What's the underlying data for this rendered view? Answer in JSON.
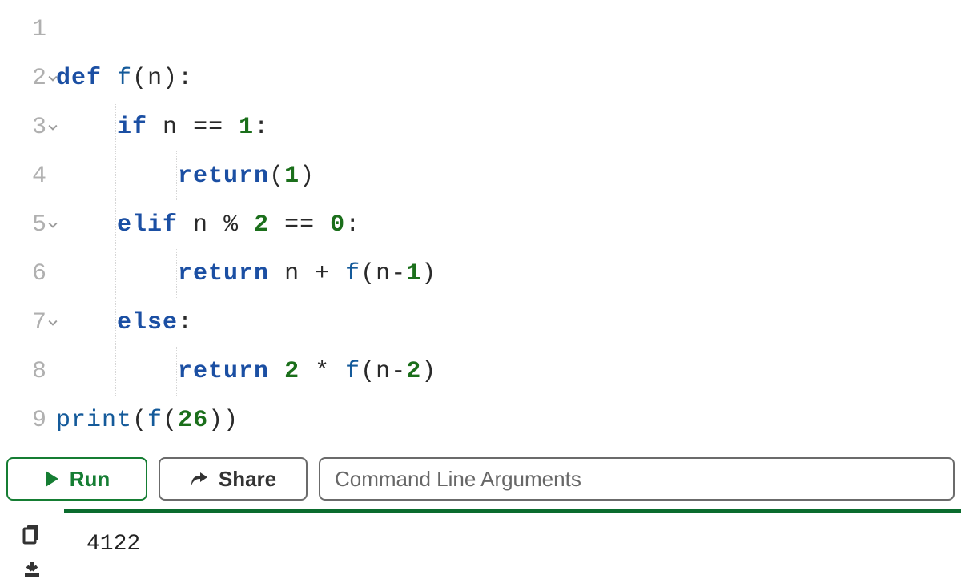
{
  "gutter": {
    "lines": [
      "1",
      "2",
      "3",
      "4",
      "5",
      "6",
      "7",
      "8",
      "9"
    ],
    "foldable": [
      false,
      true,
      true,
      false,
      true,
      false,
      true,
      false,
      false
    ]
  },
  "code": {
    "l1": "",
    "l2": {
      "kw_def": "def",
      "fn": "f",
      "lp": "(",
      "arg": "n",
      "rp": ")",
      "colon": ":"
    },
    "l3": {
      "kw_if": "if",
      "id": "n",
      "op": "==",
      "num": "1",
      "colon": ":"
    },
    "l4": {
      "kw_return": "return",
      "lp": "(",
      "num": "1",
      "rp": ")"
    },
    "l5": {
      "kw_elif": "elif",
      "id": "n",
      "mod": "%",
      "two": "2",
      "op": "==",
      "zero": "0",
      "colon": ":"
    },
    "l6": {
      "kw_return": "return",
      "id_n": "n",
      "plus": "+",
      "fn": "f",
      "lp": "(",
      "id_n2": "n",
      "minus": "-",
      "one": "1",
      "rp": ")"
    },
    "l7": {
      "kw_else": "else",
      "colon": ":"
    },
    "l8": {
      "kw_return": "return",
      "two": "2",
      "star": "*",
      "fn": "f",
      "lp": "(",
      "id_n": "n",
      "minus": "-",
      "two2": "2",
      "rp": ")"
    },
    "l9": {
      "fn_print": "print",
      "lp": "(",
      "fn_f": "f",
      "lp2": "(",
      "num": "26",
      "rp2": ")",
      "rp": ")"
    }
  },
  "toolbar": {
    "run_label": "Run",
    "share_label": "Share",
    "cli_placeholder": "Command Line Arguments"
  },
  "output": {
    "text": "4122"
  }
}
